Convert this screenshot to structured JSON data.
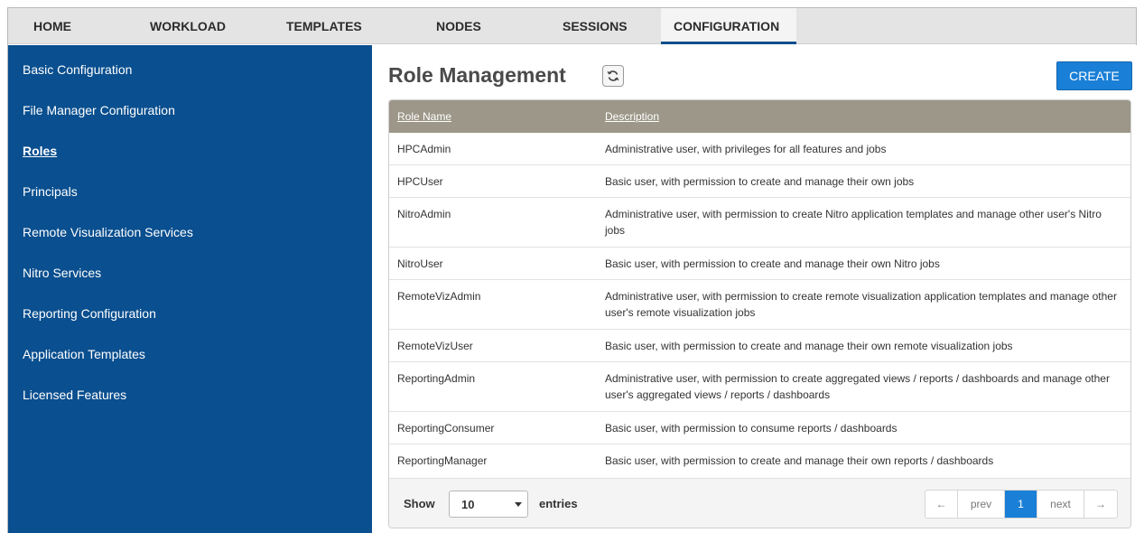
{
  "topnav": {
    "tabs": [
      {
        "label": "HOME"
      },
      {
        "label": "WORKLOAD"
      },
      {
        "label": "TEMPLATES"
      },
      {
        "label": "NODES"
      },
      {
        "label": "SESSIONS"
      },
      {
        "label": "CONFIGURATION",
        "active": true
      }
    ]
  },
  "sidebar": {
    "items": [
      {
        "label": "Basic Configuration"
      },
      {
        "label": "File Manager Configuration"
      },
      {
        "label": "Roles",
        "active": true
      },
      {
        "label": "Principals"
      },
      {
        "label": "Remote Visualization Services"
      },
      {
        "label": "Nitro Services"
      },
      {
        "label": "Reporting Configuration"
      },
      {
        "label": "Application Templates"
      },
      {
        "label": "Licensed Features"
      }
    ]
  },
  "main": {
    "title": "Role Management",
    "refresh_icon": "refresh-icon",
    "create_label": "CREATE",
    "table": {
      "columns": [
        "Role Name",
        "Description"
      ],
      "rows": [
        {
          "name": "HPCAdmin",
          "description": "Administrative user, with privileges for all features and jobs"
        },
        {
          "name": "HPCUser",
          "description": "Basic user, with permission to create and manage their own jobs"
        },
        {
          "name": "NitroAdmin",
          "description": "Administrative user, with permission to create Nitro application templates and manage other user's Nitro jobs"
        },
        {
          "name": "NitroUser",
          "description": "Basic user, with permission to create and manage their own Nitro jobs"
        },
        {
          "name": "RemoteVizAdmin",
          "description": "Administrative user, with permission to create remote visualization application templates and manage other user's remote visualization jobs"
        },
        {
          "name": "RemoteVizUser",
          "description": "Basic user, with permission to create and manage their own remote visualization jobs"
        },
        {
          "name": "ReportingAdmin",
          "description": "Administrative user, with permission to create aggregated views / reports / dashboards and manage other user's aggregated views / reports / dashboards"
        },
        {
          "name": "ReportingConsumer",
          "description": "Basic user, with permission to consume reports / dashboards"
        },
        {
          "name": "ReportingManager",
          "description": "Basic user, with permission to create and manage their own reports / dashboards"
        }
      ]
    },
    "footer": {
      "show_label": "Show",
      "page_size": "10",
      "entries_label": "entries",
      "pager": {
        "first_arrow": "←",
        "prev": "prev",
        "current": "1",
        "next": "next",
        "last_arrow": "→"
      }
    }
  },
  "colors": {
    "sidebar_bg": "#0a4f8f",
    "header_bg": "#9c9788",
    "accent": "#1a7fd6"
  }
}
